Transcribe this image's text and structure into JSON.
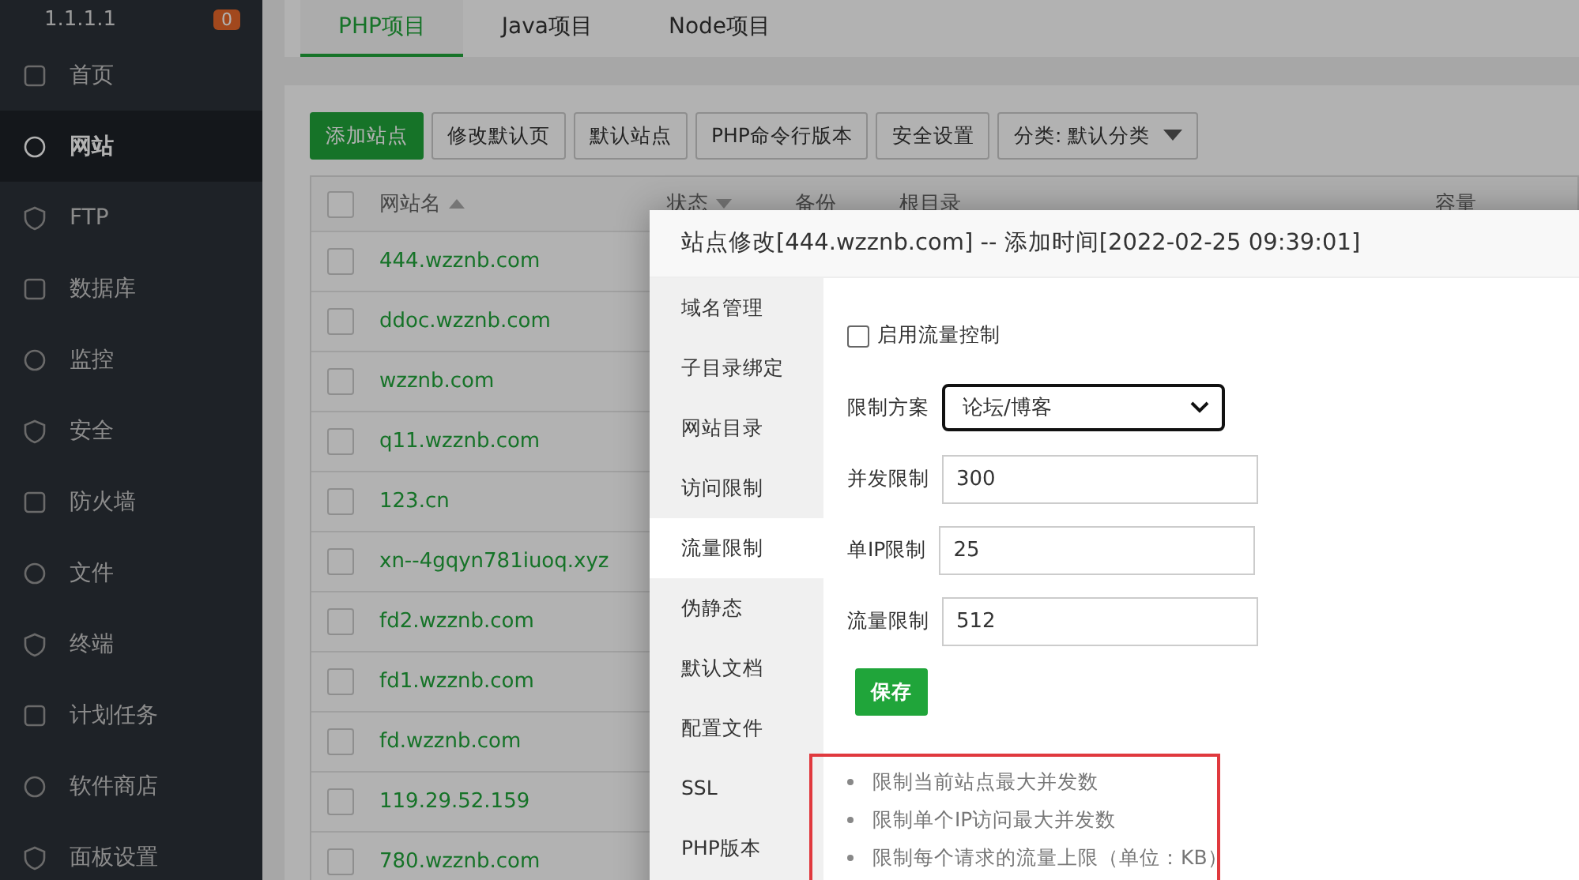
{
  "sidebar": {
    "server": "1.1.1.1",
    "badge": "0",
    "items": [
      {
        "label": "首页",
        "selected": false
      },
      {
        "label": "网站",
        "selected": true
      },
      {
        "label": "FTP",
        "selected": false
      },
      {
        "label": "数据库",
        "selected": false
      },
      {
        "label": "监控",
        "selected": false
      },
      {
        "label": "安全",
        "selected": false
      },
      {
        "label": "防火墙",
        "selected": false
      },
      {
        "label": "文件",
        "selected": false
      },
      {
        "label": "终端",
        "selected": false
      },
      {
        "label": "计划任务",
        "selected": false
      },
      {
        "label": "软件商店",
        "selected": false
      },
      {
        "label": "面板设置",
        "selected": false
      }
    ]
  },
  "tabs": [
    {
      "label": "PHP项目",
      "selected": true
    },
    {
      "label": "Java项目",
      "selected": false
    },
    {
      "label": "Node项目",
      "selected": false
    }
  ],
  "toolbar": {
    "buttons": [
      {
        "label": "添加站点",
        "kind": "primary"
      },
      {
        "label": "修改默认页",
        "kind": "plain"
      },
      {
        "label": "默认站点",
        "kind": "plain"
      },
      {
        "label": "PHP命令行版本",
        "kind": "plain"
      },
      {
        "label": "安全设置",
        "kind": "plain"
      },
      {
        "label": "分类: 默认分类",
        "kind": "dropdown"
      }
    ]
  },
  "table": {
    "select_all": {
      "checked": false
    },
    "columns": [
      "网站名",
      "状态",
      "备份",
      "根目录",
      "容量"
    ],
    "rows": [
      {
        "name": "444.wzznb.com",
        "checked": false
      },
      {
        "name": "ddoc.wzznb.com",
        "checked": false
      },
      {
        "name": "wzznb.com",
        "checked": false
      },
      {
        "name": "q11.wzznb.com",
        "checked": false
      },
      {
        "name": "123.cn",
        "checked": false
      },
      {
        "name": "xn--4gqyn781iuoq.xyz",
        "checked": false
      },
      {
        "name": "fd2.wzznb.com",
        "checked": false
      },
      {
        "name": "fd1.wzznb.com",
        "checked": false
      },
      {
        "name": "fd.wzznb.com",
        "checked": false
      },
      {
        "name": "119.29.52.159",
        "checked": false
      },
      {
        "name": "780.wzznb.com",
        "checked": false
      }
    ]
  },
  "dialog": {
    "title": "站点修改[444.wzznb.com] -- 添加时间[2022-02-25 09:39:01]",
    "nav": [
      {
        "label": "域名管理",
        "selected": false
      },
      {
        "label": "子目录绑定",
        "selected": false
      },
      {
        "label": "网站目录",
        "selected": false
      },
      {
        "label": "访问限制",
        "selected": false
      },
      {
        "label": "流量限制",
        "selected": true
      },
      {
        "label": "伪静态",
        "selected": false
      },
      {
        "label": "默认文档",
        "selected": false
      },
      {
        "label": "配置文件",
        "selected": false
      },
      {
        "label": "SSL",
        "selected": false
      },
      {
        "label": "PHP版本",
        "selected": false
      }
    ],
    "enable": {
      "label": "启用流量控制",
      "checked": false
    },
    "scheme": {
      "label": "限制方案",
      "value": "论坛/博客"
    },
    "fields": [
      {
        "label": "并发限制",
        "value": "300"
      },
      {
        "label": "单IP限制",
        "value": "25"
      },
      {
        "label": "流量限制",
        "value": "512"
      }
    ],
    "save": "保存",
    "notes": [
      "限制当前站点最大并发数",
      "限制单个IP访问最大并发数",
      "限制每个请求的流量上限（单位：KB）"
    ]
  }
}
